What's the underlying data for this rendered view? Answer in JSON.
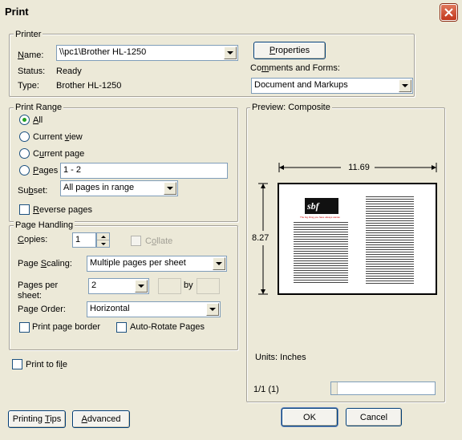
{
  "window": {
    "title": "Print"
  },
  "printer": {
    "legend": "Printer",
    "name_label": "Name:",
    "name_value": "\\\\pc1\\Brother HL-1250",
    "status_label": "Status:",
    "status_value": "Ready",
    "type_label": "Type:",
    "type_value": "Brother HL-1250",
    "properties_label": "Properties",
    "comments_label": "Comments and Forms:",
    "comments_value": "Document and Markups"
  },
  "print_range": {
    "legend": "Print Range",
    "all_label": "All",
    "current_view_label": "Current view",
    "current_page_label": "Current page",
    "pages_label": "Pages",
    "pages_value": "1 - 2",
    "subset_label": "Subset:",
    "subset_value": "All pages in range",
    "reverse_label": "Reverse pages"
  },
  "page_handling": {
    "legend": "Page Handling",
    "copies_label": "Copies:",
    "copies_value": "1",
    "collate_label": "Collate",
    "scaling_label": "Page Scaling:",
    "scaling_value": "Multiple pages per sheet",
    "per_sheet_label_1": "Pages per",
    "per_sheet_label_2": "sheet:",
    "per_sheet_value": "2",
    "by_label": "by",
    "order_label": "Page Order:",
    "order_value": "Horizontal",
    "border_label": "Print page border",
    "autorotate_label": "Auto-Rotate Pages"
  },
  "print_to_file_label": "Print to file",
  "preview": {
    "legend": "Preview: Composite",
    "width_dim": "11.69",
    "height_dim": "8.27",
    "units": "Units: Inches",
    "page_counter": "1/1 (1)",
    "logo_text": "sbf",
    "tagline": "The big thing you have always wanted"
  },
  "buttons": {
    "printing_tips": "Printing Tips",
    "advanced": "Advanced",
    "ok": "OK",
    "cancel": "Cancel"
  },
  "colors": {
    "accent_text": "#cc0000",
    "radio_dot": "#21a121",
    "close_button": "#c2371c"
  }
}
